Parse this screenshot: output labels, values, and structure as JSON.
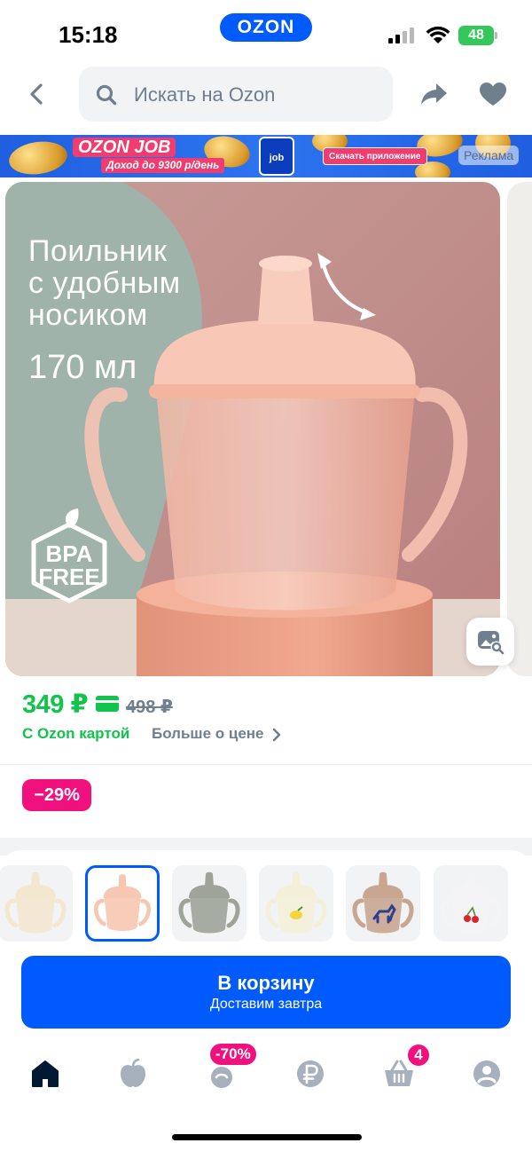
{
  "status_bar": {
    "time": "15:18",
    "brand": "OZON",
    "battery": "48"
  },
  "header": {
    "search_placeholder": "Искать на Ozon"
  },
  "ad_banner": {
    "title": "OZON JOB",
    "subtitle": "Доход до 9300 р/день",
    "phone_label": "job",
    "cta": "Скачать приложение",
    "label": "Реклама"
  },
  "product": {
    "hero_text_line1": "Поильник",
    "hero_text_line2": "с удобным",
    "hero_text_line3": "носиком",
    "hero_volume": "170 мл",
    "badge_line1": "BPA",
    "badge_line2": "FREE"
  },
  "price": {
    "current": "349 ₽",
    "old": "498 ₽",
    "card_label": "С Ozon картой",
    "more_label": "Больше о цене",
    "discount": "−29%"
  },
  "variants": [
    {
      "name": "cream",
      "color": "#f3e7cf",
      "selected": false
    },
    {
      "name": "peach",
      "color": "#f6c8b3",
      "selected": true
    },
    {
      "name": "olive-gray",
      "color": "#9fa49a",
      "selected": false
    },
    {
      "name": "lemon",
      "color": "#f3efd9",
      "selected": false
    },
    {
      "name": "horse",
      "color": "#c9a692",
      "selected": false
    },
    {
      "name": "cherry",
      "color": "#f4f4f6",
      "selected": false
    }
  ],
  "cart_button": {
    "label": "В корзину",
    "sub": "Доставим завтра"
  },
  "bottom_nav": {
    "promo_badge": "-70%",
    "cart_badge": "4"
  },
  "colors": {
    "brand_blue": "#005bff",
    "price_green": "#10c44c",
    "badge_pink": "#f1117e"
  }
}
